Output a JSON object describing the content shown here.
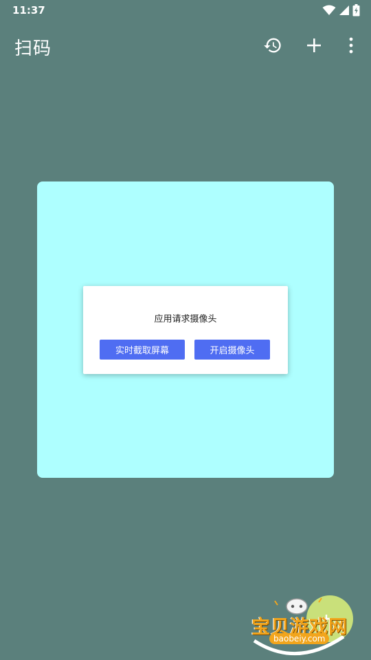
{
  "status_bar": {
    "time": "11:37",
    "icons": [
      "wifi-icon",
      "signal-icon",
      "battery-charging-icon"
    ]
  },
  "app_bar": {
    "title": "扫码",
    "actions": [
      "history-icon",
      "add-icon",
      "more-vert-icon"
    ]
  },
  "scan_panel": {
    "color": "#aeffff"
  },
  "permission_dialog": {
    "message": "应用请求摄像头",
    "capture_screen_label": "实时截取屏幕",
    "open_camera_label": "开启摄像头",
    "button_color": "#4f6df2"
  },
  "watermark": {
    "title": "宝贝游戏网",
    "url": "baobeiy.com"
  },
  "colors": {
    "background": "#5b807c",
    "accent": "#4f6df2"
  }
}
